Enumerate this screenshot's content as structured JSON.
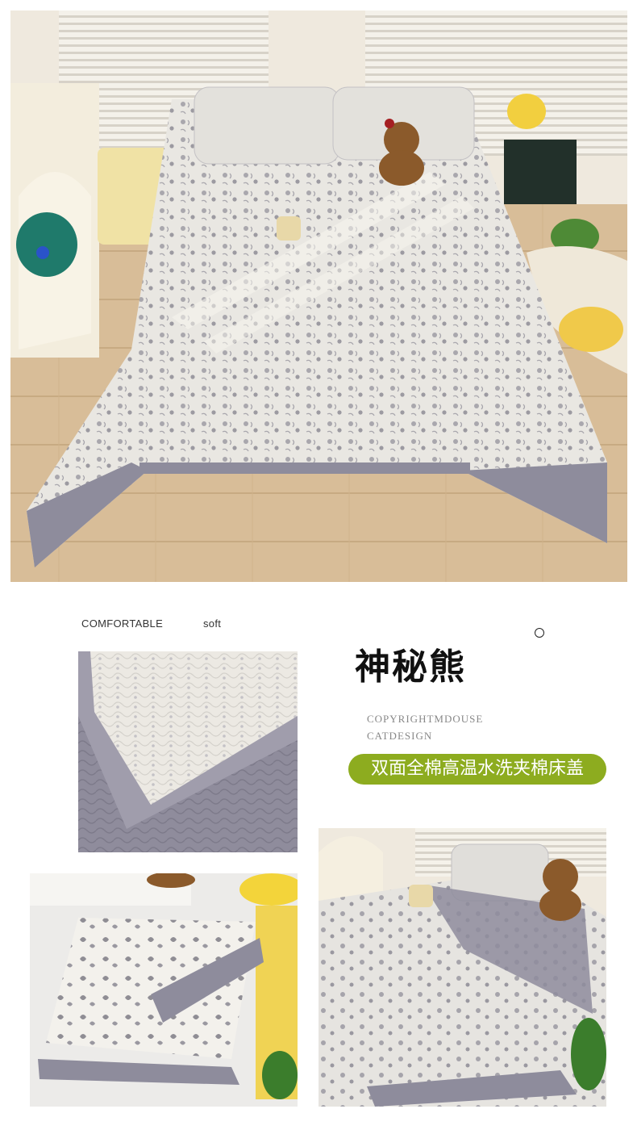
{
  "labels": {
    "comfortable": "COMFORTABLE",
    "soft": "soft"
  },
  "product": {
    "name": "神秘熊",
    "copyright_line1": "COPYRIGHTMDOUSE",
    "copyright_line2": "CATDESIGN",
    "description": "双面全棉高温水洗夹棉床盖"
  },
  "colors": {
    "accent_green": "#8dac1f",
    "border_gray": "#8e8c9c",
    "fabric_white": "#eeece6",
    "floor_wood": "#d9bf9a"
  },
  "icons": [
    "circle-outline-icon"
  ]
}
